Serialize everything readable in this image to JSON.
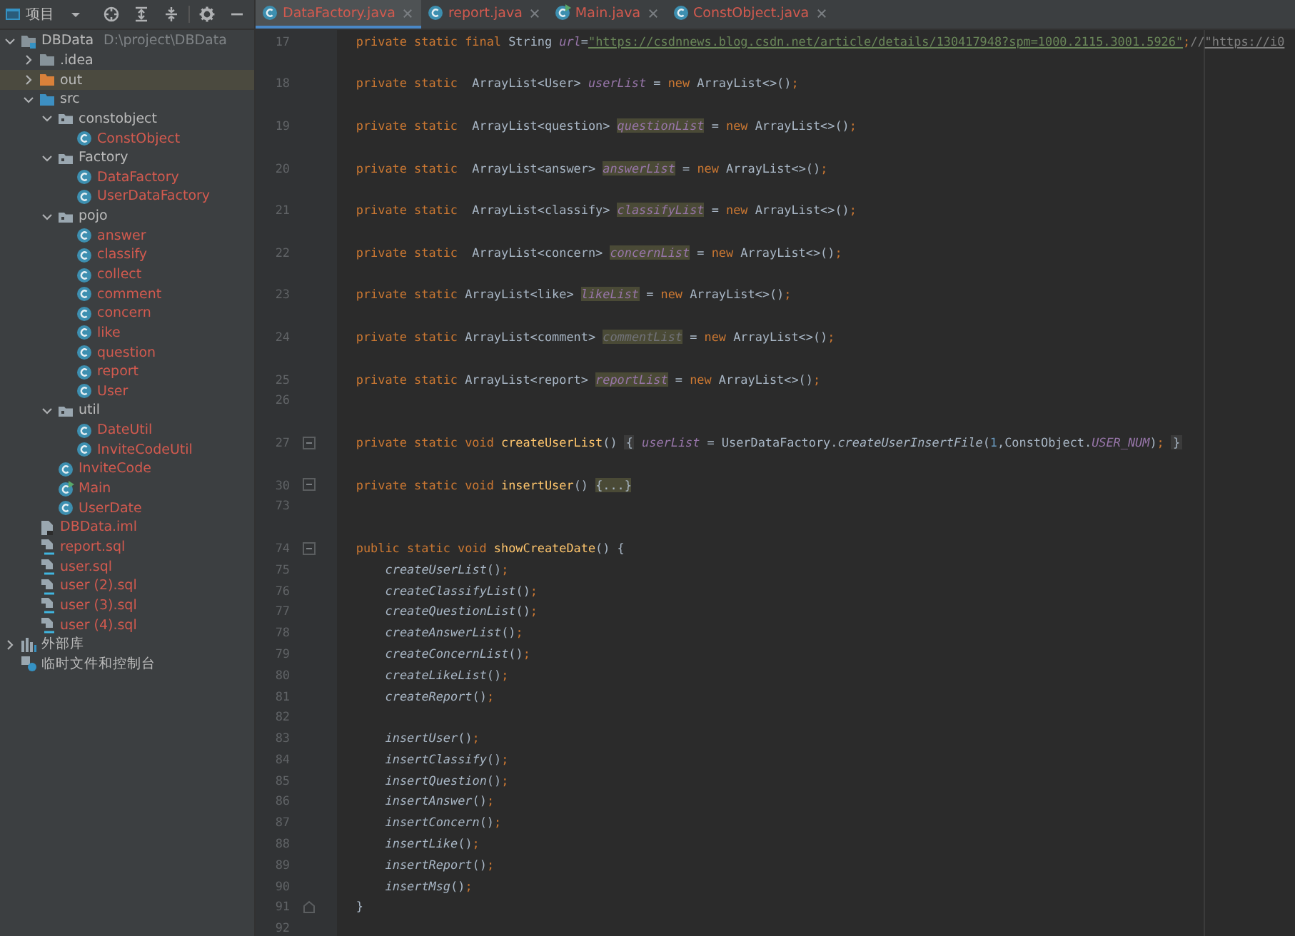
{
  "project_panel": {
    "title": "项目",
    "tree": [
      {
        "name": "DBData",
        "path": "D:\\project\\DBData",
        "kind": "module",
        "unversioned": false,
        "selected": false,
        "expanded": true,
        "children": [
          {
            "name": ".idea",
            "kind": "folder",
            "unversioned": false,
            "selected": false,
            "expanded": false
          },
          {
            "name": "out",
            "kind": "excluded-folder",
            "unversioned": false,
            "selected": true,
            "expanded": false
          },
          {
            "name": "src",
            "kind": "source-folder",
            "unversioned": false,
            "selected": false,
            "expanded": true,
            "children": [
              {
                "name": "constobject",
                "kind": "package",
                "unversioned": false,
                "selected": false,
                "expanded": true,
                "children": [
                  {
                    "name": "ConstObject",
                    "kind": "class",
                    "unversioned": true,
                    "selected": false
                  }
                ]
              },
              {
                "name": "Factory",
                "kind": "package",
                "unversioned": false,
                "selected": false,
                "expanded": true,
                "children": [
                  {
                    "name": "DataFactory",
                    "kind": "class",
                    "unversioned": true,
                    "selected": false
                  },
                  {
                    "name": "UserDataFactory",
                    "kind": "class",
                    "unversioned": true,
                    "selected": false
                  }
                ]
              },
              {
                "name": "pojo",
                "kind": "package",
                "unversioned": false,
                "selected": false,
                "expanded": true,
                "children": [
                  {
                    "name": "answer",
                    "kind": "class",
                    "unversioned": true,
                    "selected": false
                  },
                  {
                    "name": "classify",
                    "kind": "class",
                    "unversioned": true,
                    "selected": false
                  },
                  {
                    "name": "collect",
                    "kind": "class",
                    "unversioned": true,
                    "selected": false
                  },
                  {
                    "name": "comment",
                    "kind": "class",
                    "unversioned": true,
                    "selected": false
                  },
                  {
                    "name": "concern",
                    "kind": "class",
                    "unversioned": true,
                    "selected": false
                  },
                  {
                    "name": "like",
                    "kind": "class",
                    "unversioned": true,
                    "selected": false
                  },
                  {
                    "name": "question",
                    "kind": "class",
                    "unversioned": true,
                    "selected": false
                  },
                  {
                    "name": "report",
                    "kind": "class",
                    "unversioned": true,
                    "selected": false
                  },
                  {
                    "name": "User",
                    "kind": "class",
                    "unversioned": true,
                    "selected": false
                  }
                ]
              },
              {
                "name": "util",
                "kind": "package",
                "unversioned": false,
                "selected": false,
                "expanded": true,
                "children": [
                  {
                    "name": "DateUtil",
                    "kind": "class",
                    "unversioned": true,
                    "selected": false
                  },
                  {
                    "name": "InviteCodeUtil",
                    "kind": "class",
                    "unversioned": true,
                    "selected": false
                  }
                ]
              },
              {
                "name": "InviteCode",
                "kind": "class",
                "unversioned": true,
                "selected": false
              },
              {
                "name": "Main",
                "kind": "main-class",
                "unversioned": true,
                "selected": false
              },
              {
                "name": "UserDate",
                "kind": "class",
                "unversioned": true,
                "selected": false
              }
            ]
          },
          {
            "name": "DBData.iml",
            "kind": "iml-file",
            "unversioned": true,
            "selected": false
          },
          {
            "name": "report.sql",
            "kind": "sql-file",
            "unversioned": true,
            "selected": false
          },
          {
            "name": "user.sql",
            "kind": "sql-file",
            "unversioned": true,
            "selected": false
          },
          {
            "name": "user (2).sql",
            "kind": "sql-file",
            "unversioned": true,
            "selected": false
          },
          {
            "name": "user (3).sql",
            "kind": "sql-file",
            "unversioned": true,
            "selected": false
          },
          {
            "name": "user (4).sql",
            "kind": "sql-file",
            "unversioned": true,
            "selected": false
          }
        ]
      },
      {
        "name": "外部库",
        "kind": "library",
        "unversioned": false,
        "selected": false,
        "expanded": false
      },
      {
        "name": "临时文件和控制台",
        "kind": "scratch",
        "unversioned": false,
        "selected": false
      }
    ]
  },
  "editor_tabs": [
    {
      "label": "DataFactory.java",
      "kind": "class",
      "selected": true
    },
    {
      "label": "report.java",
      "kind": "class",
      "selected": false
    },
    {
      "label": "Main.java",
      "kind": "main-class",
      "selected": false
    },
    {
      "label": "ConstObject.java",
      "kind": "class",
      "selected": false
    }
  ],
  "code_lines": [
    {
      "number": "17",
      "kind": "member",
      "tokens": [
        {
          "text": "private static final ",
          "kind": "kw"
        },
        {
          "text": "String ",
          "kind": "plain"
        },
        {
          "text": "url",
          "kind": "field"
        },
        {
          "text": "=",
          "kind": "plain"
        },
        {
          "text": "\"https://csdnnews.blog.csdn.net/article/details/130417948?spm=1000.2115.3001.5926\"",
          "kind": "str-link"
        },
        {
          "text": ";",
          "kind": "punct"
        },
        {
          "text": "//",
          "kind": "comment"
        },
        {
          "text": "\"https://i0",
          "kind": "comment-link"
        }
      ]
    },
    {
      "number": "18",
      "kind": "member",
      "tokens": [
        {
          "text": "private static ",
          "kind": "kw"
        },
        {
          "text": " ArrayList<User> ",
          "kind": "plain"
        },
        {
          "text": "userList",
          "kind": "field"
        },
        {
          "text": " = ",
          "kind": "plain"
        },
        {
          "text": "new ",
          "kind": "kw"
        },
        {
          "text": "ArrayList<>()",
          "kind": "plain"
        },
        {
          "text": ";",
          "kind": "punct"
        }
      ]
    },
    {
      "number": "19",
      "kind": "member",
      "tokens": [
        {
          "text": "private static ",
          "kind": "kw"
        },
        {
          "text": " ArrayList<question> ",
          "kind": "plain"
        },
        {
          "text": "questionList",
          "kind": "field-hl"
        },
        {
          "text": " = ",
          "kind": "plain"
        },
        {
          "text": "new ",
          "kind": "kw"
        },
        {
          "text": "ArrayList<>()",
          "kind": "plain"
        },
        {
          "text": ";",
          "kind": "punct"
        }
      ]
    },
    {
      "number": "20",
      "kind": "member",
      "tokens": [
        {
          "text": "private static ",
          "kind": "kw"
        },
        {
          "text": " ArrayList<answer> ",
          "kind": "plain"
        },
        {
          "text": "answerList",
          "kind": "field-hl"
        },
        {
          "text": " = ",
          "kind": "plain"
        },
        {
          "text": "new ",
          "kind": "kw"
        },
        {
          "text": "ArrayList<>()",
          "kind": "plain"
        },
        {
          "text": ";",
          "kind": "punct"
        }
      ]
    },
    {
      "number": "21",
      "kind": "member",
      "tokens": [
        {
          "text": "private static ",
          "kind": "kw"
        },
        {
          "text": " ArrayList<classify> ",
          "kind": "plain"
        },
        {
          "text": "classifyList",
          "kind": "field-hl"
        },
        {
          "text": " = ",
          "kind": "plain"
        },
        {
          "text": "new ",
          "kind": "kw"
        },
        {
          "text": "ArrayList<>()",
          "kind": "plain"
        },
        {
          "text": ";",
          "kind": "punct"
        }
      ]
    },
    {
      "number": "22",
      "kind": "member",
      "tokens": [
        {
          "text": "private static ",
          "kind": "kw"
        },
        {
          "text": " ArrayList<concern> ",
          "kind": "plain"
        },
        {
          "text": "concernList",
          "kind": "field-hl"
        },
        {
          "text": " = ",
          "kind": "plain"
        },
        {
          "text": "new ",
          "kind": "kw"
        },
        {
          "text": "ArrayList<>()",
          "kind": "plain"
        },
        {
          "text": ";",
          "kind": "punct"
        }
      ]
    },
    {
      "number": "23",
      "kind": "member",
      "tokens": [
        {
          "text": "private static ",
          "kind": "kw"
        },
        {
          "text": "ArrayList<like> ",
          "kind": "plain"
        },
        {
          "text": "likeList",
          "kind": "field-hl"
        },
        {
          "text": " = ",
          "kind": "plain"
        },
        {
          "text": "new ",
          "kind": "kw"
        },
        {
          "text": "ArrayList<>()",
          "kind": "plain"
        },
        {
          "text": ";",
          "kind": "punct"
        }
      ]
    },
    {
      "number": "24",
      "kind": "member",
      "tokens": [
        {
          "text": "private static ",
          "kind": "kw"
        },
        {
          "text": "ArrayList<comment> ",
          "kind": "plain"
        },
        {
          "text": "commentList",
          "kind": "unused-hl"
        },
        {
          "text": " = ",
          "kind": "plain"
        },
        {
          "text": "new ",
          "kind": "kw"
        },
        {
          "text": "ArrayList<>()",
          "kind": "plain"
        },
        {
          "text": ";",
          "kind": "punct"
        }
      ]
    },
    {
      "number": "25",
      "kind": "member",
      "tokens": [
        {
          "text": "private static ",
          "kind": "kw"
        },
        {
          "text": "ArrayList<report> ",
          "kind": "plain"
        },
        {
          "text": "reportList",
          "kind": "field-hl"
        },
        {
          "text": " = ",
          "kind": "plain"
        },
        {
          "text": "new ",
          "kind": "kw"
        },
        {
          "text": "ArrayList<>()",
          "kind": "plain"
        },
        {
          "text": ";",
          "kind": "punct"
        }
      ]
    },
    {
      "number": "26",
      "kind": "blank"
    },
    {
      "number": "27",
      "kind": "member-fold",
      "tokens": [
        {
          "text": "private static void ",
          "kind": "kw"
        },
        {
          "text": "createUserList",
          "kind": "method"
        },
        {
          "text": "() ",
          "kind": "plain"
        },
        {
          "text": "{",
          "kind": "brace-open"
        },
        {
          "text": "userList",
          "kind": "field"
        },
        {
          "text": " = UserDataFactory.",
          "kind": "plain"
        },
        {
          "text": "createUserInsertFile",
          "kind": "call"
        },
        {
          "text": "(",
          "kind": "plain"
        },
        {
          "text": "1",
          "kind": "num"
        },
        {
          "text": ",ConstObject.",
          "kind": "plain"
        },
        {
          "text": "USER_NUM",
          "kind": "field"
        },
        {
          "text": ")",
          "kind": "plain"
        },
        {
          "text": ";",
          "kind": "punct"
        },
        {
          "text": "}",
          "kind": "brace-close"
        }
      ]
    },
    {
      "number": "30",
      "kind": "member-fold",
      "tokens": [
        {
          "text": "private static void ",
          "kind": "kw"
        },
        {
          "text": "insertUser",
          "kind": "method"
        },
        {
          "text": "() ",
          "kind": "plain"
        },
        {
          "text": "{...}",
          "kind": "folded-hl"
        }
      ]
    },
    {
      "number": "73",
      "kind": "blank"
    },
    {
      "number": "74",
      "kind": "member-fold",
      "tokens": [
        {
          "text": "public static void ",
          "kind": "kw"
        },
        {
          "text": "showCreateDate",
          "kind": "method"
        },
        {
          "text": "() {",
          "kind": "plain"
        }
      ]
    },
    {
      "number": "75",
      "kind": "body",
      "tokens": [
        {
          "text": "createUserList",
          "kind": "call"
        },
        {
          "text": "()",
          "kind": "plain"
        },
        {
          "text": ";",
          "kind": "punct"
        }
      ]
    },
    {
      "number": "76",
      "kind": "body",
      "tokens": [
        {
          "text": "createClassifyList",
          "kind": "call"
        },
        {
          "text": "()",
          "kind": "plain"
        },
        {
          "text": ";",
          "kind": "punct"
        }
      ]
    },
    {
      "number": "77",
      "kind": "body",
      "tokens": [
        {
          "text": "createQuestionList",
          "kind": "call"
        },
        {
          "text": "()",
          "kind": "plain"
        },
        {
          "text": ";",
          "kind": "punct"
        }
      ]
    },
    {
      "number": "78",
      "kind": "body",
      "tokens": [
        {
          "text": "createAnswerList",
          "kind": "call"
        },
        {
          "text": "()",
          "kind": "plain"
        },
        {
          "text": ";",
          "kind": "punct"
        }
      ]
    },
    {
      "number": "79",
      "kind": "body",
      "tokens": [
        {
          "text": "createConcernList",
          "kind": "call"
        },
        {
          "text": "()",
          "kind": "plain"
        },
        {
          "text": ";",
          "kind": "punct"
        }
      ]
    },
    {
      "number": "80",
      "kind": "body",
      "tokens": [
        {
          "text": "createLikeList",
          "kind": "call"
        },
        {
          "text": "()",
          "kind": "plain"
        },
        {
          "text": ";",
          "kind": "punct"
        }
      ]
    },
    {
      "number": "81",
      "kind": "body",
      "tokens": [
        {
          "text": "createReport",
          "kind": "call"
        },
        {
          "text": "()",
          "kind": "plain"
        },
        {
          "text": ";",
          "kind": "punct"
        }
      ]
    },
    {
      "number": "82",
      "kind": "blank"
    },
    {
      "number": "83",
      "kind": "body",
      "tokens": [
        {
          "text": "insertUser",
          "kind": "call"
        },
        {
          "text": "()",
          "kind": "plain"
        },
        {
          "text": ";",
          "kind": "punct"
        }
      ]
    },
    {
      "number": "84",
      "kind": "body",
      "tokens": [
        {
          "text": "insertClassify",
          "kind": "call"
        },
        {
          "text": "()",
          "kind": "plain"
        },
        {
          "text": ";",
          "kind": "punct"
        }
      ]
    },
    {
      "number": "85",
      "kind": "body",
      "tokens": [
        {
          "text": "insertQuestion",
          "kind": "call"
        },
        {
          "text": "()",
          "kind": "plain"
        },
        {
          "text": ";",
          "kind": "punct"
        }
      ]
    },
    {
      "number": "86",
      "kind": "body",
      "tokens": [
        {
          "text": "insertAnswer",
          "kind": "call"
        },
        {
          "text": "()",
          "kind": "plain"
        },
        {
          "text": ";",
          "kind": "punct"
        }
      ]
    },
    {
      "number": "87",
      "kind": "body",
      "tokens": [
        {
          "text": "insertConcern",
          "kind": "call"
        },
        {
          "text": "()",
          "kind": "plain"
        },
        {
          "text": ";",
          "kind": "punct"
        }
      ]
    },
    {
      "number": "88",
      "kind": "body",
      "tokens": [
        {
          "text": "insertLike",
          "kind": "call"
        },
        {
          "text": "()",
          "kind": "plain"
        },
        {
          "text": ";",
          "kind": "punct"
        }
      ]
    },
    {
      "number": "89",
      "kind": "body",
      "tokens": [
        {
          "text": "insertReport",
          "kind": "call"
        },
        {
          "text": "()",
          "kind": "plain"
        },
        {
          "text": ";",
          "kind": "punct"
        }
      ]
    },
    {
      "number": "90",
      "kind": "body",
      "tokens": [
        {
          "text": "insertMsg",
          "kind": "call"
        },
        {
          "text": "()",
          "kind": "plain"
        },
        {
          "text": ";",
          "kind": "punct"
        }
      ]
    },
    {
      "number": "91",
      "kind": "fold-end",
      "tokens": [
        {
          "text": "}",
          "kind": "plain"
        }
      ]
    },
    {
      "number": "92",
      "kind": "blank"
    }
  ]
}
